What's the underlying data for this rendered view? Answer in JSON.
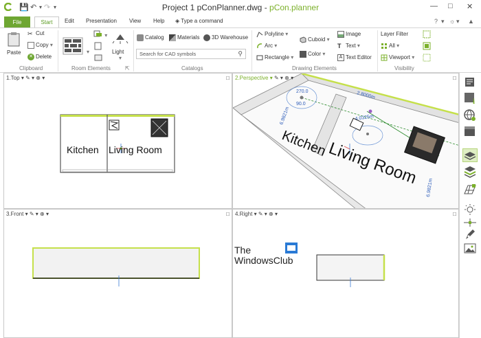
{
  "title": {
    "project": "Project 1 pConPlanner.dwg",
    "separator": "-",
    "brand": "pCon.planner"
  },
  "tabs": {
    "file": "File",
    "start": "Start",
    "edit": "Edit",
    "presentation": "Presentation",
    "view": "View",
    "help": "Help",
    "command": "Type a command"
  },
  "ribbon": {
    "clipboard": {
      "paste": "Paste",
      "cut": "Cut",
      "copy": "Copy",
      "delete": "Delete",
      "group": "Clipboard"
    },
    "room": {
      "light": "Light",
      "group": "Room Elements"
    },
    "catalogs": {
      "catalog": "Catalog",
      "materials": "Materials",
      "warehouse": "3D Warehouse",
      "search_placeholder": "Search for CAD symbols",
      "group": "Catalogs"
    },
    "drawing": {
      "polyline": "Polyline",
      "arc": "Arc",
      "rectangle": "Rectangle",
      "cuboid": "Cuboid",
      "color": "Color",
      "image": "Image",
      "text": "Text",
      "text_editor": "Text Editor",
      "group": "Drawing Elements"
    },
    "visibility": {
      "layer_filter": "Layer Filter",
      "all": "All",
      "viewport": "Viewport",
      "group": "Visibility"
    }
  },
  "viewports": {
    "top": {
      "label": "1.Top",
      "rooms": [
        "Kitchen",
        "Living Room"
      ]
    },
    "perspective": {
      "label": "2.Perspective",
      "rooms": [
        "Kitchen",
        "Living Room"
      ],
      "dims": [
        "2.8000m",
        "4.0325m",
        "6.9821m",
        "90.0",
        "270.0"
      ]
    },
    "front": {
      "label": "3.Front"
    },
    "right": {
      "label": "4.Right",
      "watermark_line1": "The",
      "watermark_line2": "WindowsClub"
    }
  },
  "colors": {
    "accent": "#7bb02a",
    "file_tab": "#6ea632",
    "wall_highlight": "#c5e04a"
  },
  "sidebar_icons": [
    "articles-icon",
    "info-icon",
    "globe-icon",
    "box-icon",
    "layers-icon",
    "layer-stack-icon",
    "grid-icon",
    "light-icon",
    "measure-icon",
    "pen-icon",
    "image-icon"
  ]
}
